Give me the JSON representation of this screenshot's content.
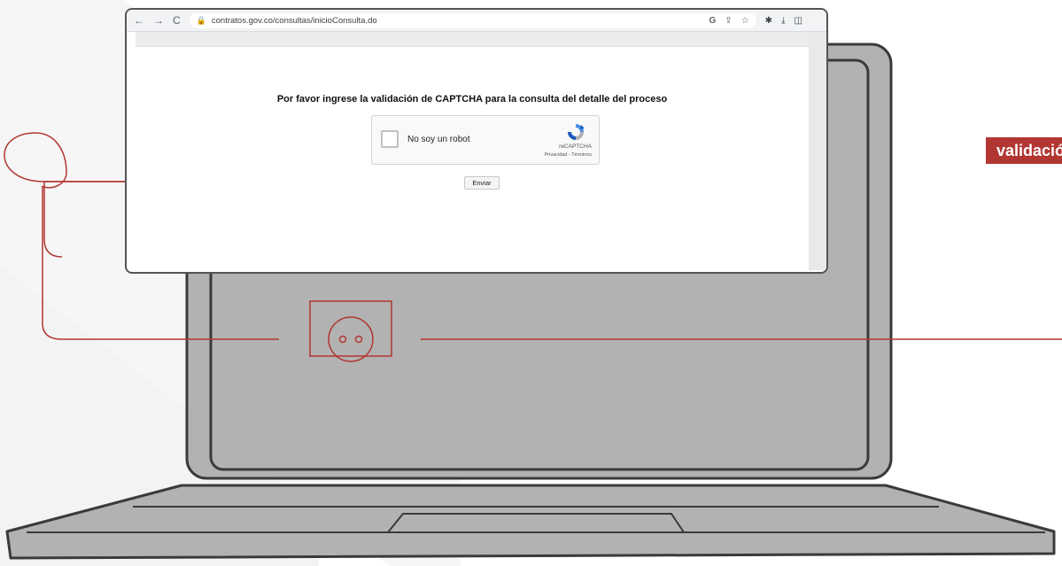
{
  "browser": {
    "nav": {
      "back_icon": "←",
      "forward_icon": "→",
      "reload_icon": "C"
    },
    "address": {
      "lock_icon": "🔒",
      "url": "contratos.gov.co/consultas/inicioConsulta.do",
      "google_icon": "G",
      "share_icon": "⇪",
      "star_icon": "☆"
    },
    "tools": {
      "extension_icon": "✱",
      "download_icon": "⤓",
      "sidebar_icon": "◫"
    }
  },
  "page": {
    "prompt": "Por favor ingrese la validación de CAPTCHA para la consulta del detalle del proceso",
    "recaptcha": {
      "label": "No soy un robot",
      "brand": "reCAPTCHA",
      "links": "Privacidad - Términos"
    },
    "submit_label": "Enviar"
  },
  "tag": {
    "text": "validación"
  },
  "colors": {
    "accent": "#b23632",
    "laptop_body": "#b2b2b2",
    "laptop_outline": "#3a3a3a"
  }
}
